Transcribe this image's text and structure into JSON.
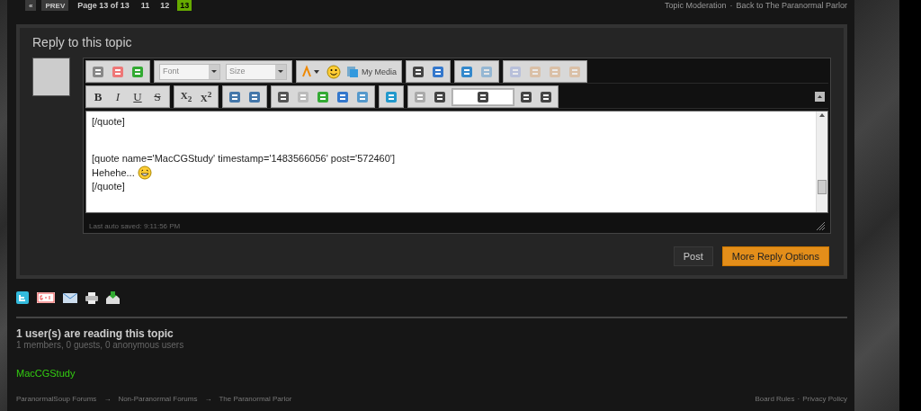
{
  "pagination": {
    "first": "«",
    "prev": "PREV",
    "label": "Page 13 of 13",
    "pages": [
      {
        "label": "11",
        "selected": false
      },
      {
        "label": "12",
        "selected": false
      },
      {
        "label": "13",
        "selected": true
      }
    ]
  },
  "top_links": [
    "Topic Moderation",
    "Back to The Paranormal Parlor"
  ],
  "reply": {
    "title": "Reply to this topic",
    "toolbar": {
      "font": "Font",
      "size": "Size",
      "media": "My Media",
      "format_buttons": [
        {
          "label": "B",
          "kind": "bold"
        },
        {
          "label": "I",
          "kind": "italic"
        },
        {
          "label": "U",
          "kind": "underline"
        },
        {
          "label": "S",
          "kind": "strike"
        }
      ],
      "script_buttons": [
        {
          "label": "X$_{2}$"
        },
        {
          "label": "X$^{2}$"
        }
      ]
    },
    "lines": [
      {
        "kind": "text",
        "text": "[/quote]"
      },
      {
        "kind": "gap"
      },
      {
        "kind": "gap"
      },
      {
        "kind": "text",
        "text": "[quote name='MacCGStudy' timestamp='1483566056' post='572460']"
      },
      {
        "kind": "emoticon",
        "text": "Hehehe..."
      },
      {
        "kind": "text",
        "text": "[/quote]"
      }
    ],
    "autosave": "Last auto saved: 9:11:56 PM",
    "buttons": [
      {
        "label": "Post",
        "kind": "secondary"
      },
      {
        "label": "More Reply Options",
        "kind": "primary"
      }
    ]
  },
  "readers": {
    "title": "1 user(s) are reading this topic",
    "counts": "1 members, 0 guests, 0 anonymous users",
    "users": [
      "MacCGStudy"
    ]
  },
  "breadcrumb": [
    "ParanormalSoup Forums",
    "Non-Paranormal Forums",
    "The Paranormal Parlor"
  ],
  "breadcrumb_separator": "→",
  "footer_links": [
    "Board Rules",
    "Privacy Policy"
  ],
  "link_separator": "·"
}
